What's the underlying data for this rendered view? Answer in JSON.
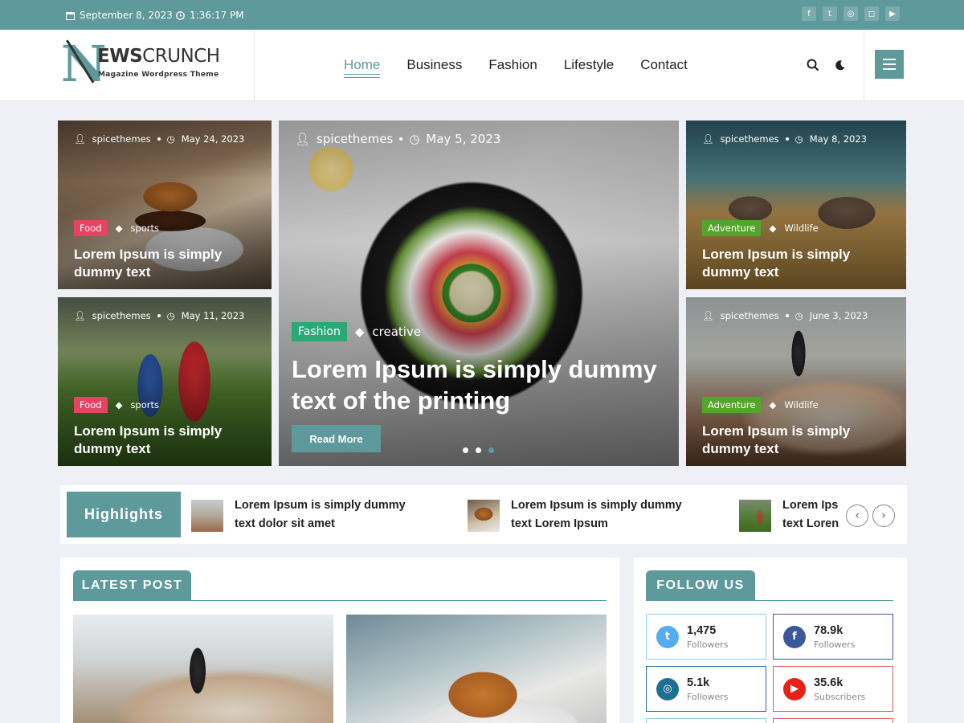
{
  "topbar": {
    "date": "September 8, 2023",
    "time": "1:36:17 PM",
    "socials": [
      "facebook-icon",
      "twitter-icon",
      "dribbble-icon",
      "instagram-icon",
      "youtube-icon"
    ]
  },
  "header": {
    "logo_word_bold": "EWS",
    "logo_word_light": "CRUNCH",
    "logo_tagline": "Magazine Wordpress Theme",
    "nav": [
      "Home",
      "Business",
      "Fashion",
      "Lifestyle",
      "Contact"
    ],
    "active_nav": "Home"
  },
  "colors": {
    "accent": "#5e999b",
    "food_badge": "#e44462",
    "adventure_badge": "#54a52b",
    "fashion_badge": "#2aa875"
  },
  "hero": {
    "left_top": {
      "author": "spicethemes",
      "date": "May 24, 2023",
      "category": "Food",
      "tag": "sports",
      "title": "Lorem Ipsum is simply dummy text"
    },
    "left_bottom": {
      "author": "spicethemes",
      "date": "May 11, 2023",
      "category": "Food",
      "tag": "sports",
      "title": "Lorem Ipsum is simply dummy text"
    },
    "center": {
      "author": "spicethemes",
      "date": "May 5, 2023",
      "category": "Fashion",
      "tag": "creative",
      "title": "Lorem Ipsum is simply dummy text of the printing",
      "button": "Read More"
    },
    "right_top": {
      "author": "spicethemes",
      "date": "May 8, 2023",
      "category": "Adventure",
      "tag": "Wildlife",
      "title": "Lorem Ipsum is simply dummy text"
    },
    "right_bottom": {
      "author": "spicethemes",
      "date": "June 3, 2023",
      "category": "Adventure",
      "tag": "Wildlife",
      "title": "Lorem Ipsum is simply dummy text"
    }
  },
  "highlights": {
    "label": "Highlights",
    "items": [
      {
        "line1": "Lorem Ipsum is simply dummy",
        "line2": "text dolor sit amet"
      },
      {
        "line1": "Lorem Ipsum is simply dummy",
        "line2": "text Lorem Ipsum"
      },
      {
        "line1": "Lorem Ips",
        "line2": "text Loren"
      }
    ]
  },
  "latest": {
    "title": "LATEST POST"
  },
  "follow": {
    "title": "FOLLOW US",
    "items": [
      {
        "count": "1,475",
        "label": "Followers",
        "color": "#55acee"
      },
      {
        "count": "78.9k",
        "label": "Followers",
        "color": "#3b5998"
      },
      {
        "count": "5.1k",
        "label": "Followers",
        "color": "#1f6f93"
      },
      {
        "count": "35.6k",
        "label": "Subscribers",
        "color": "#e62117"
      }
    ]
  }
}
